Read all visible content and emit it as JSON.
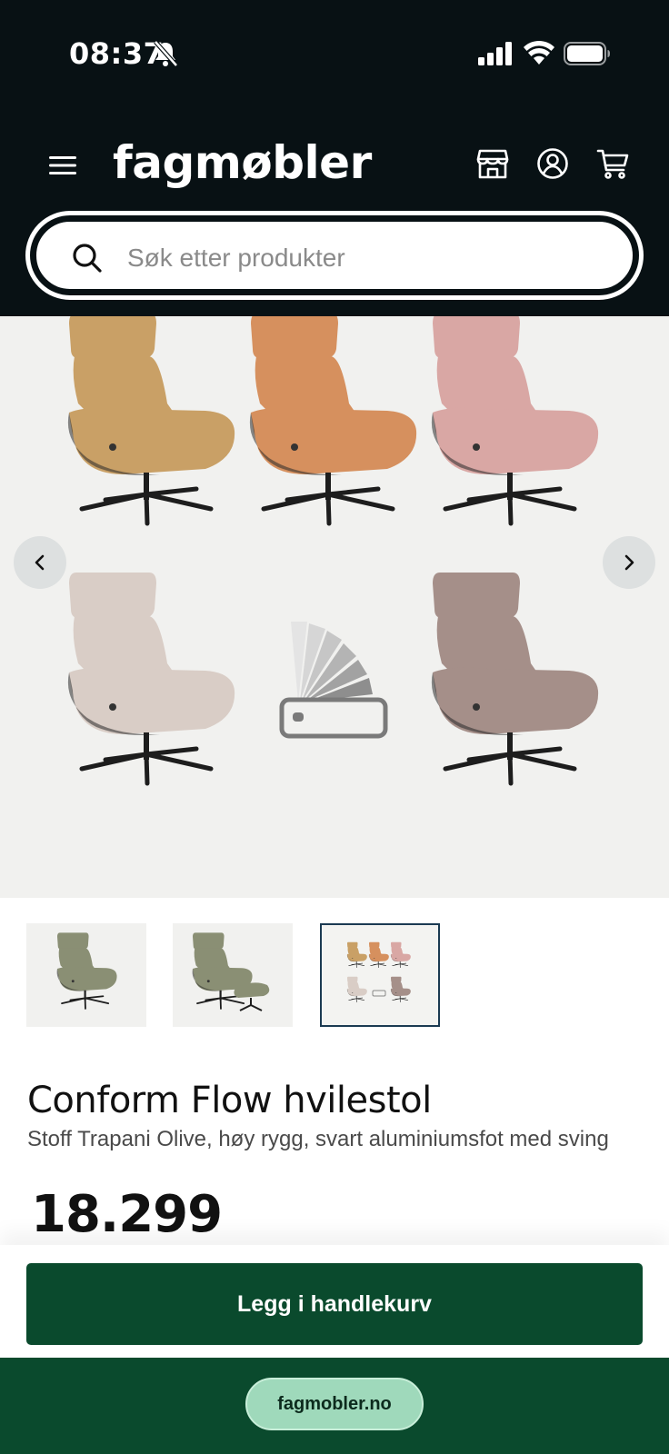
{
  "status_bar": {
    "time": "08:37",
    "icons": [
      "bell-slash-icon",
      "cellular-signal-icon",
      "wifi-icon",
      "battery-icon"
    ]
  },
  "header": {
    "logo": "fagmøbler",
    "icons": [
      "menu-icon",
      "store-icon",
      "user-icon",
      "cart-icon"
    ]
  },
  "search": {
    "placeholder": "Søk etter produkter",
    "value": ""
  },
  "gallery": {
    "image_description_icons": [
      "chevron-left-icon",
      "chevron-right-icon"
    ],
    "chair_colors": [
      "#c9a066",
      "#d6905e",
      "#d9a7a4",
      "#d9cdc6",
      "#a58f89"
    ]
  },
  "thumbnails": {
    "count": 3,
    "selected_index": 2
  },
  "product": {
    "title": "Conform Flow hvilestol",
    "subtitle": "Stoff Trapani Olive, høy rygg, svart aluminiumsfot med sving",
    "price": "18.299"
  },
  "actions": {
    "add_to_cart_label": "Legg i handlekurv"
  },
  "browser": {
    "url": "fagmobler.no"
  },
  "colors": {
    "header_bg": "#081114",
    "brand_green": "#0a4a2d",
    "url_pill": "#9fd9bb"
  }
}
